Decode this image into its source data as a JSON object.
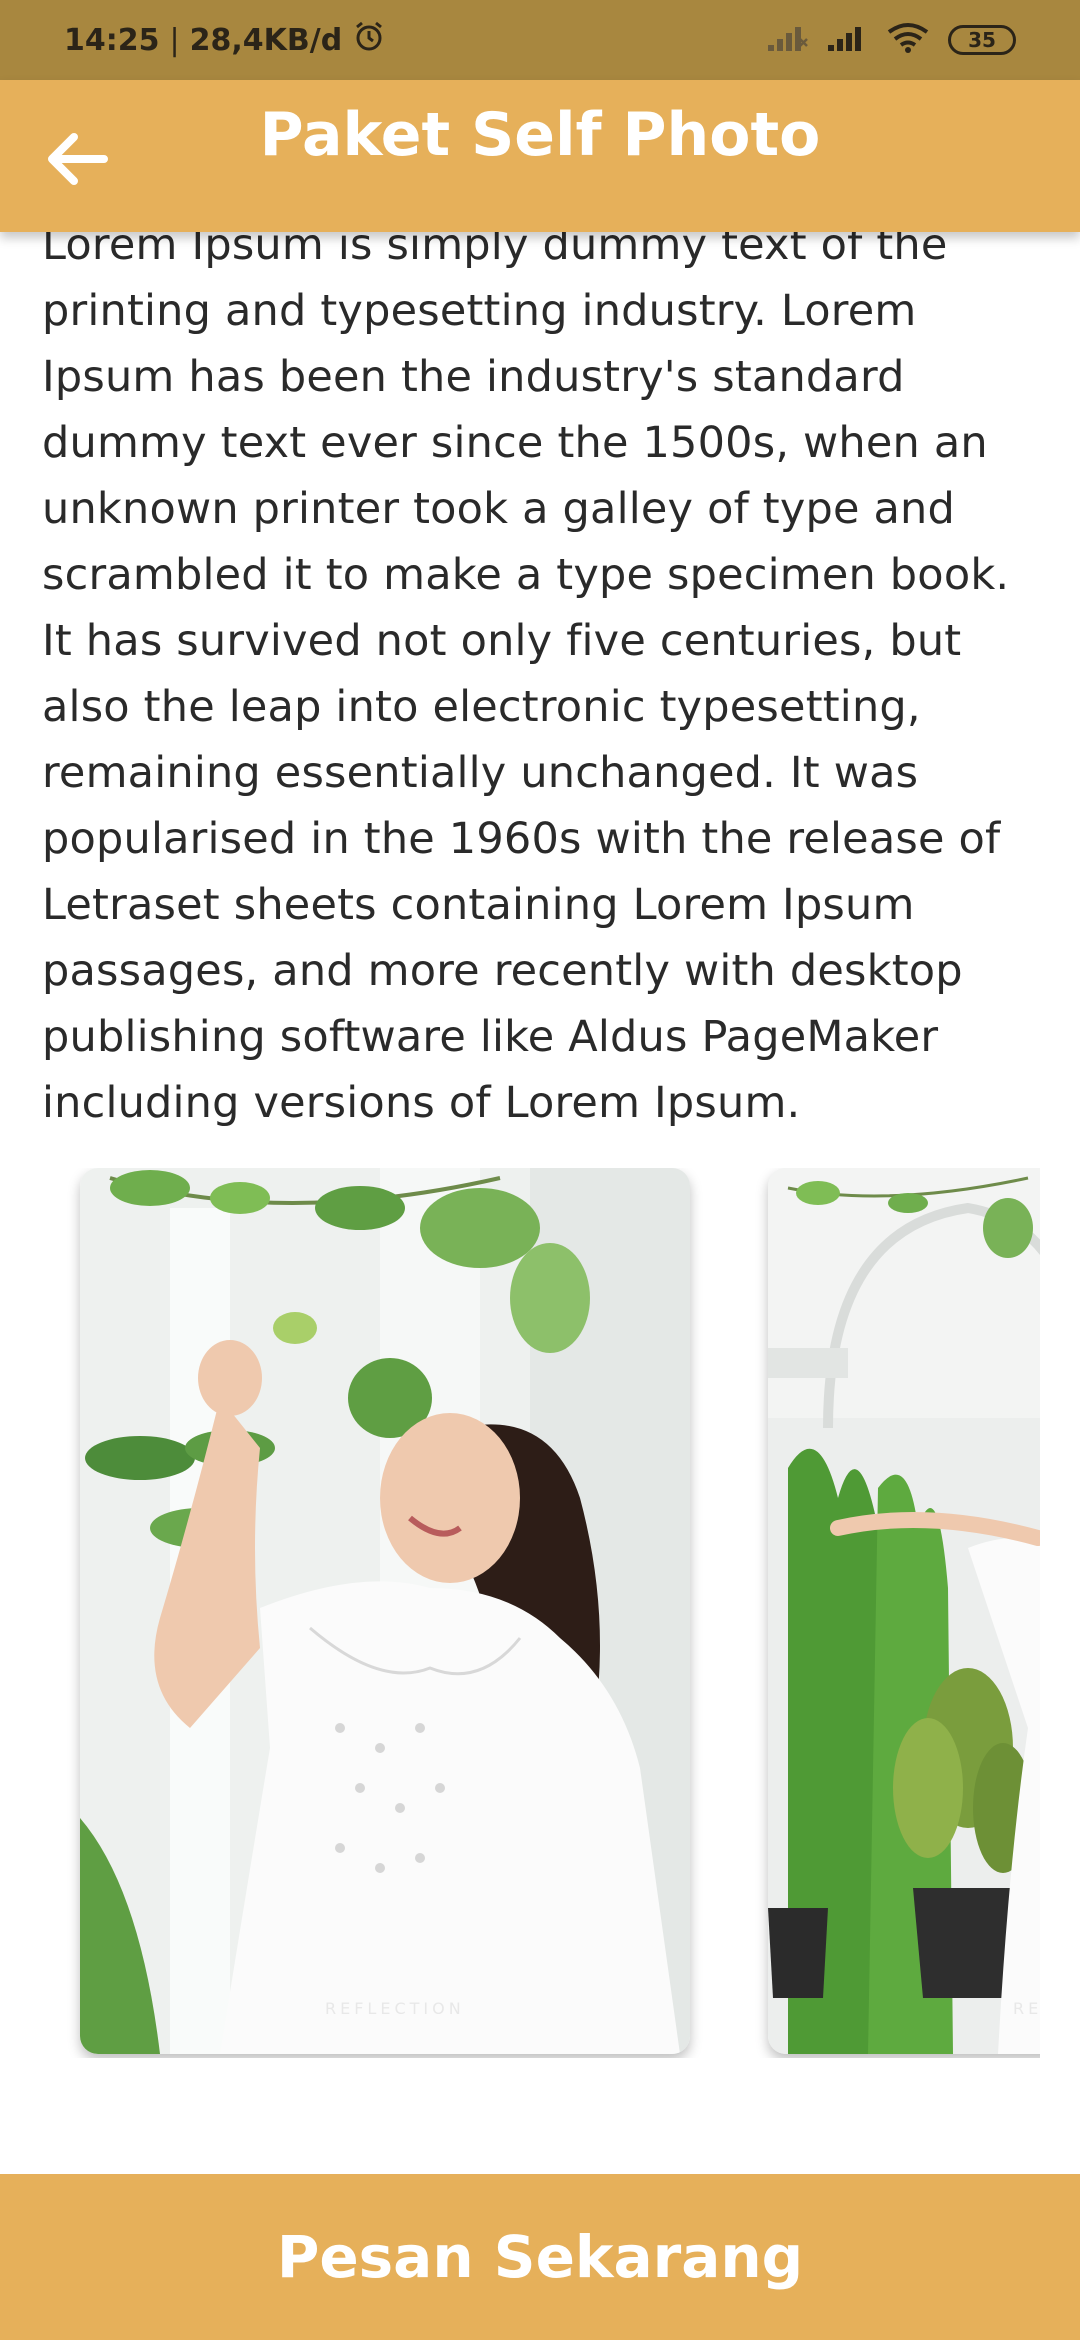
{
  "status_bar": {
    "time": "14:25",
    "separator": "|",
    "data_rate": "28,4KB/d",
    "battery_level": "35"
  },
  "app_bar": {
    "title": "Paket Self Photo"
  },
  "content": {
    "description": "Lorem Ipsum is simply dummy text of the printing and typesetting industry. Lorem Ipsum has been the industry's standard dummy text ever since the 1500s, when an unknown printer took a galley of type and scrambled it to make a type specimen book. It has survived not only five centuries, but also the leap into electronic typesetting, remaining essentially unchanged. It was popularised in the 1960s with the release of Letraset sheets containing Lorem Ipsum passages, and more recently with desktop publishing software like Aldus PageMaker including versions of Lorem Ipsum."
  },
  "gallery": {
    "watermark": "REFLECTION"
  },
  "order_button": {
    "label": "Pesan Sekarang"
  },
  "colors": {
    "status_bar": "#a8873f",
    "accent": "#e6b05a",
    "text": "#2a2a2a"
  }
}
